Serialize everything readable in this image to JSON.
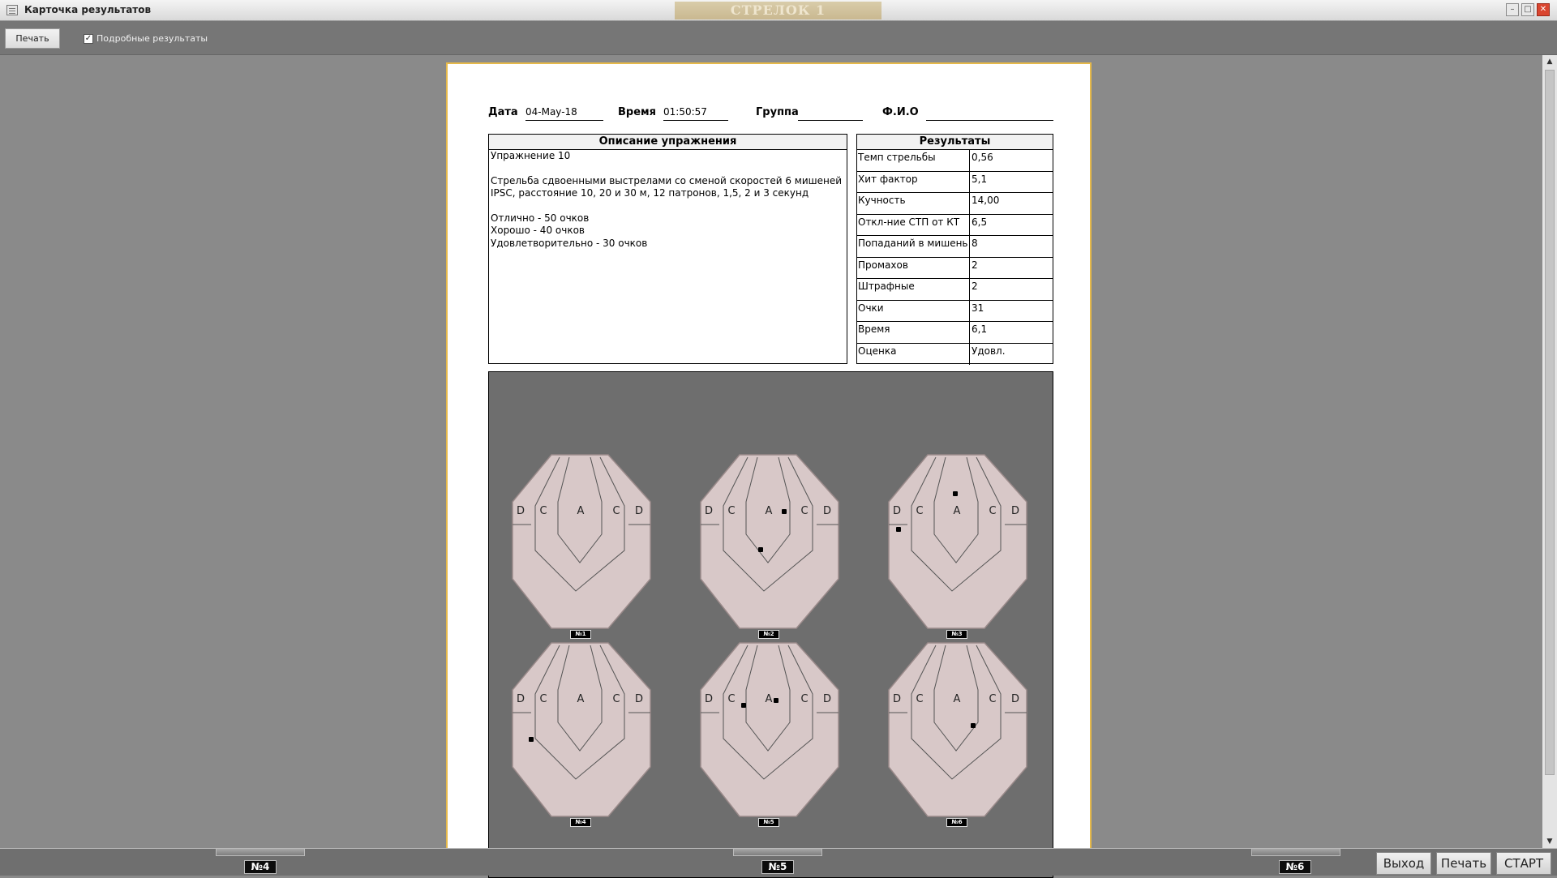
{
  "window": {
    "title": "Карточка результатов",
    "shooter": "СТРЕЛОК 1"
  },
  "toolbar": {
    "print_label": "Печать",
    "detailed_label": "Подробные результаты",
    "detailed_checked": true
  },
  "header": {
    "date_label": "Дата",
    "date_value": "04-May-18",
    "time_label": "Время",
    "time_value": "01:50:57",
    "group_label": "Группа",
    "group_value": "",
    "fio_label": "Ф.И.О",
    "fio_value": ""
  },
  "description": {
    "title": "Описание упражнения",
    "lines": [
      "Упражнение 10",
      "",
      "Стрельба сдвоенными выстрелами со сменой скоростей 6 мишеней",
      "IPSC, расстояние 10, 20 и 30 м, 12 патронов, 1,5, 2 и 3 секунд",
      "",
      "Отлично - 50 очков",
      "Хорошо - 40 очков",
      "Удовлетворительно - 30 очков"
    ]
  },
  "results": {
    "title": "Результаты",
    "rows": [
      {
        "label": "Темп стрельбы",
        "value": "0,56"
      },
      {
        "label": "Хит фактор",
        "value": "5,1"
      },
      {
        "label": "Кучность",
        "value": "14,00"
      },
      {
        "label": "Откл-ние СТП от КТ",
        "value": "6,5"
      },
      {
        "label": "Попаданий в мишень",
        "value": "8"
      },
      {
        "label": "Промахов",
        "value": "2"
      },
      {
        "label": "Штрафные",
        "value": "2"
      },
      {
        "label": "Очки",
        "value": "31"
      },
      {
        "label": "Время",
        "value": "6,1"
      },
      {
        "label": "Оценка",
        "value": "Удовл."
      }
    ]
  },
  "targets": {
    "zone_labels": [
      "D",
      "C",
      "A",
      "C",
      "D"
    ],
    "items": [
      {
        "label": "№1"
      },
      {
        "label": "№2"
      },
      {
        "label": "№3"
      },
      {
        "label": "№4"
      },
      {
        "label": "№5"
      },
      {
        "label": "№6"
      }
    ]
  },
  "lanes": [
    "№4",
    "№5",
    "№6"
  ],
  "buttons": {
    "exit": "Выход",
    "print": "Печать",
    "start": "СТАРТ"
  },
  "colors": {
    "target_fill": "#d8c8c8",
    "target_bg": "#6e6e6e",
    "frame": "#e6b94a"
  }
}
